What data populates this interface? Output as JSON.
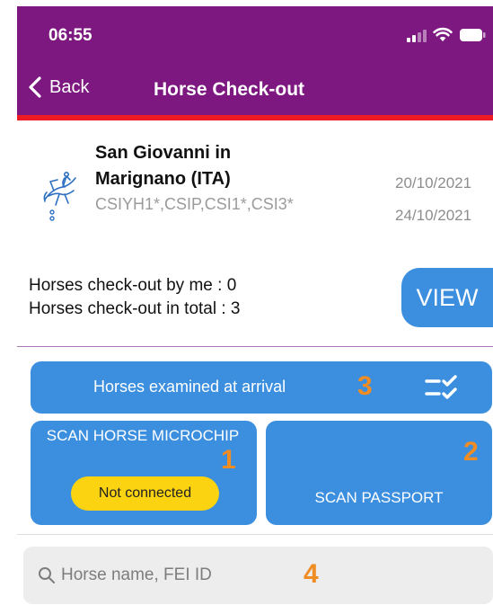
{
  "status_bar": {
    "time": "06:55",
    "icons": [
      "signal-icon",
      "wifi-icon",
      "battery-icon"
    ]
  },
  "nav": {
    "back_label": "Back",
    "title": "Horse Check-out",
    "bar_color": "#7c187f",
    "accent_line_color": "#ee1b24"
  },
  "event": {
    "name": "San Giovanni in Marignano  (ITA)",
    "codes": "CSIYH1*,CSIP,CSI1*,CSI3*",
    "date_start": "20/10/2021",
    "date_end": "24/10/2021",
    "icon": "show-jumping-icon"
  },
  "counts": {
    "by_me": "Horses check-out by me : 0",
    "total": "Horses check-out in total : 3",
    "view_label": "VIEW"
  },
  "actions": {
    "examined_label": "Horses examined at arrival",
    "examined_icon": "checklist-icon",
    "scan_chip_label": "SCAN HORSE MICROCHIP",
    "chip_status": "Not connected",
    "scan_passport_label": "SCAN PASSPORT",
    "button_color": "#3c8fdf",
    "status_badge_color": "#fbd310"
  },
  "annotations": {
    "examined": "3",
    "scan_chip": "1",
    "scan_passport": "2",
    "search": "4",
    "color": "#f08c24"
  },
  "search": {
    "placeholder": "Horse name, FEI ID",
    "value": ""
  }
}
